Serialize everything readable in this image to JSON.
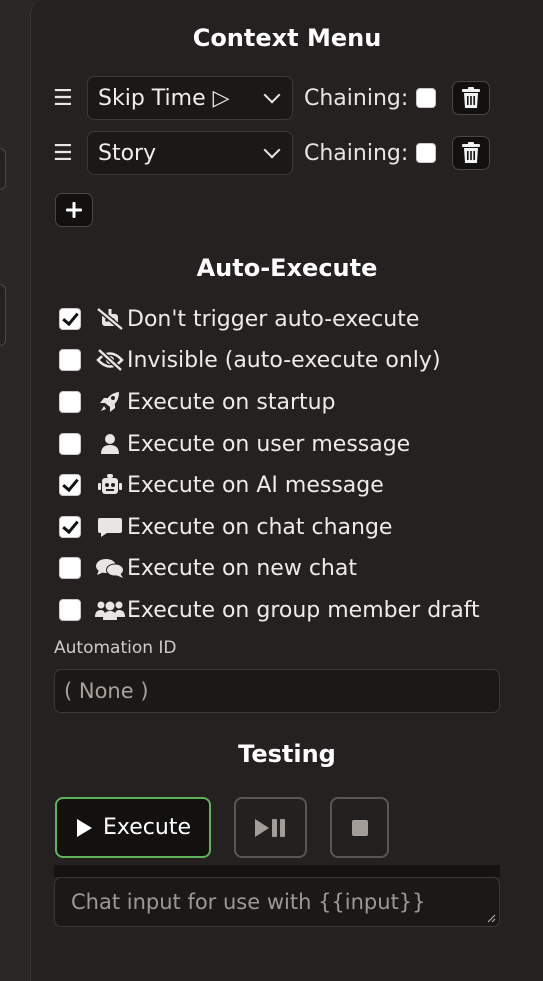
{
  "context_menu": {
    "title": "Context Menu",
    "items": [
      {
        "value": "Skip Time ▷",
        "chaining_label": "Chaining:",
        "chaining_checked": false
      },
      {
        "value": "Story",
        "chaining_label": "Chaining:",
        "chaining_checked": false
      }
    ],
    "add_button_icon": "plus-icon"
  },
  "auto_execute": {
    "title": "Auto-Execute",
    "options": [
      {
        "label": "Don't trigger auto-execute",
        "checked": true,
        "icon": "robot-slash-icon"
      },
      {
        "label": "Invisible (auto-execute only)",
        "checked": false,
        "icon": "eye-slash-icon"
      },
      {
        "label": "Execute on startup",
        "checked": false,
        "icon": "rocket-icon"
      },
      {
        "label": "Execute on user message",
        "checked": false,
        "icon": "user-icon"
      },
      {
        "label": "Execute on AI message",
        "checked": true,
        "icon": "robot-icon"
      },
      {
        "label": "Execute on chat change",
        "checked": true,
        "icon": "message-icon"
      },
      {
        "label": "Execute on new chat",
        "checked": false,
        "icon": "comments-icon"
      },
      {
        "label": "Execute on group member draft",
        "checked": false,
        "icon": "users-icon"
      }
    ]
  },
  "automation": {
    "label": "Automation ID",
    "value": "( None )"
  },
  "testing": {
    "title": "Testing",
    "execute_label": "Execute",
    "chat_input_placeholder": "Chat input for use with {{input}}"
  },
  "colors": {
    "accent_green": "#5eb35a",
    "panel_bg": "#242120"
  }
}
